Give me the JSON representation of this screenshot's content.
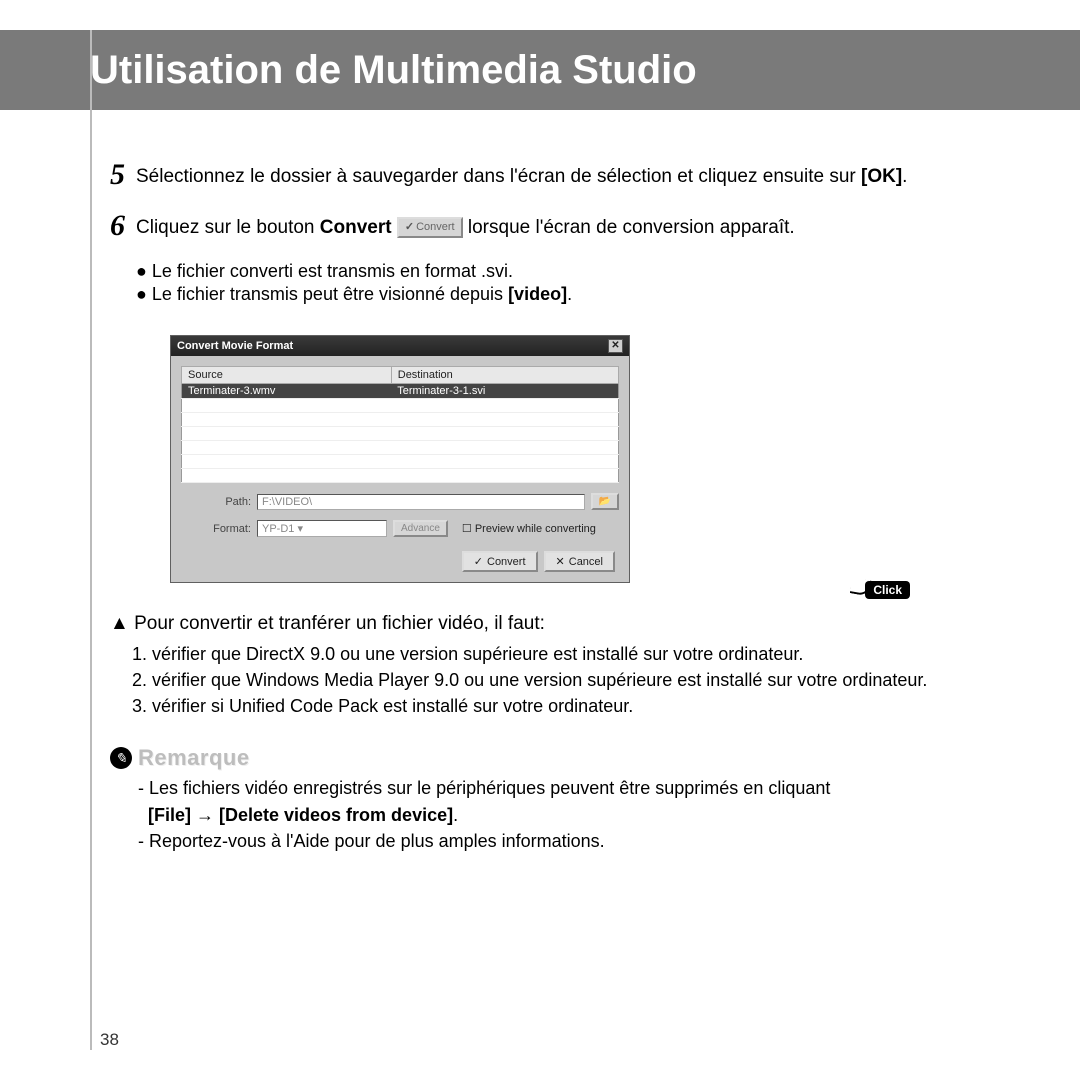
{
  "header": {
    "title": "Utilisation de Multimedia Studio"
  },
  "step5": {
    "num": "5",
    "text_a": "Sélectionnez le dossier à sauvegarder dans l'écran de sélection et cliquez ensuite sur ",
    "bold_ok": "[OK]",
    "text_b": "."
  },
  "step6": {
    "num": "6",
    "text_a": "Cliquez sur le bouton ",
    "bold_convert": "Convert",
    "btn_label": "Convert",
    "text_b": "   lorsque l'écran de conversion apparaît.",
    "bullet1": "● Le fichier converti est transmis en format .svi.",
    "bullet2_a": "● Le fichier transmis peut être visionné depuis ",
    "bullet2_bold": "[video]",
    "bullet2_b": "."
  },
  "dialog": {
    "title": "Convert Movie Format",
    "col_source": "Source",
    "col_dest": "Destination",
    "row1_src": "Terminater-3.wmv",
    "row1_dst": "Terminater-3-1.svi",
    "path_label": "Path:",
    "path_value": "F:\\VIDEO\\",
    "format_label": "Format:",
    "format_value": "YP-D1",
    "advance": "Advance",
    "preview": "Preview while converting",
    "convert": "Convert",
    "cancel": "Cancel",
    "click_tag": "Click"
  },
  "triangle": {
    "head": "▲ Pour convertir et tranférer un fichier vidéo, il faut:",
    "item1": "1. vérifier que DirectX 9.0 ou une version supérieure est installé sur votre ordinateur.",
    "item2": "2. vérifier que Windows Media Player 9.0 ou une version supérieure est installé sur votre ordinateur.",
    "item3": "3. vérifier si Unified Code Pack est installé sur votre ordinateur."
  },
  "note": {
    "title": "Remarque",
    "line1_a": "- Les fichiers vidéo enregistrés sur le périphériques peuvent être supprimés en cliquant",
    "line1_bold": "[File] → [Delete videos from device]",
    "line1_b": ".",
    "line2": "- Reportez-vous à l'Aide pour de plus amples informations."
  },
  "page_number": "38"
}
